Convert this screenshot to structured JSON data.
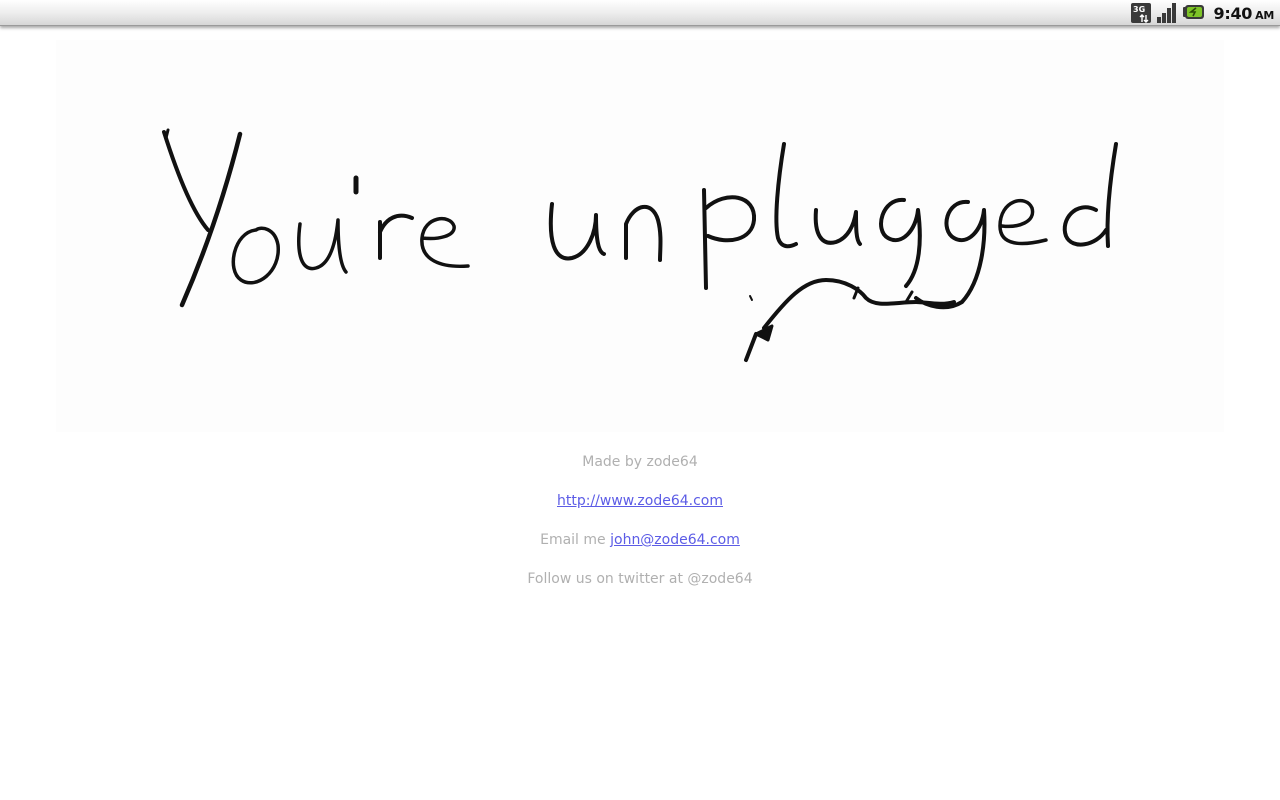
{
  "status_bar": {
    "network_type": "3G",
    "time": "9:40",
    "ampm": "AM"
  },
  "banner": {
    "handwritten_text": "You're unplugged"
  },
  "info": {
    "made_by": "Made by zode64",
    "website_link": "http://www.zode64.com",
    "email_prefix": "Email me",
    "email_link": "john@zode64.com",
    "twitter": "Follow us on twitter at @zode64"
  },
  "colors": {
    "link": "#5c5ce6",
    "muted_text": "#b0b0b0",
    "ink": "#111111"
  }
}
